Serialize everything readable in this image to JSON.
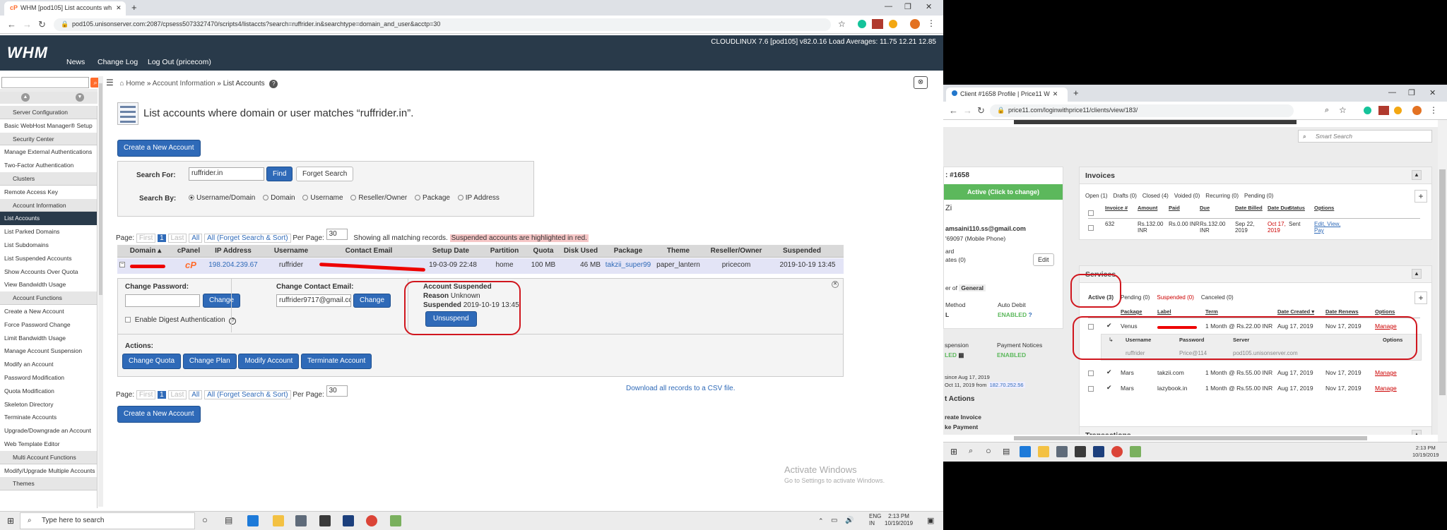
{
  "left_browser": {
    "tab_title": "WHM [pod105] List accounts wh",
    "url": "pod105.unisonserver.com:2087/cpsess5073327470/scripts4/listaccts?search=ruffrider.in&searchtype=domain_and_user&acctp=30"
  },
  "whm": {
    "logo": "WHM",
    "nav": [
      "News",
      "Change Log",
      "Log Out (pricecom)"
    ],
    "server_info": "CLOUDLINUX 7.6 [pod105]   v82.0.16   Load Averages: 11.75 12.21 12.85",
    "breadcrumb": [
      "Home",
      "Account Information",
      "List Accounts"
    ],
    "page_title": "List accounts where domain or user matches “ruffrider.in”.",
    "create_btn": "Create a New Account",
    "search_for_label": "Search For:",
    "search_value": "ruffrider.in",
    "find_btn": "Find",
    "forget_btn": "Forget Search",
    "search_by_label": "Search By:",
    "search_by_options": [
      "Username/Domain",
      "Domain",
      "Username",
      "Reseller/Owner",
      "Package",
      "IP Address"
    ],
    "pager": {
      "label": "Page:",
      "first": "First",
      "page": "1",
      "last": "Last",
      "all": "All",
      "all_forget": "All (Forget Search & Sort)",
      "per_page_label": "Per Page:",
      "per_page": "30",
      "showing": "Showing all matching records.",
      "suspended_note": "Suspended accounts are highlighted in red."
    },
    "columns": [
      "Domain ▴",
      "cPanel",
      "IP Address",
      "Username",
      "Contact Email",
      "Setup Date",
      "Partition",
      "Quota",
      "Disk Used",
      "Package",
      "Theme",
      "Reseller/Owner",
      "Suspended"
    ],
    "row": {
      "ip": "198.204.239.67",
      "username": "ruffrider",
      "setup_date": "19-03-09 22:48",
      "partition": "home",
      "quota": "100 MB",
      "disk_used": "46 MB",
      "package": "takzii_super99",
      "theme": "paper_lantern",
      "owner": "pricecom",
      "suspended": "2019-10-19 13:45"
    },
    "detail": {
      "change_password": "Change Password:",
      "change_btn": "Change",
      "digest": "Enable Digest Authentication",
      "change_email": "Change Contact Email:",
      "email_value": "ruffrider9717@gmail.cc",
      "suspended_title": "Account Suspended",
      "reason_label": "Reason",
      "reason_value": "Unknown",
      "suspended_label": "Suspended",
      "suspended_value": "2019-10-19 13:45",
      "unsuspend_btn": "Unsuspend",
      "actions_label": "Actions:",
      "actions": [
        "Change Quota",
        "Change Plan",
        "Modify Account",
        "Terminate Account"
      ]
    },
    "download_link": "Download all records to a CSV file.",
    "activate_title": "Activate Windows",
    "activate_sub": "Go to Settings to activate Windows.",
    "sidebar": [
      {
        "t": "h",
        "label": "Server Configuration"
      },
      {
        "t": "i",
        "label": "Basic WebHost Manager® Setup"
      },
      {
        "t": "h",
        "label": "Security Center"
      },
      {
        "t": "i",
        "label": "Manage External Authentications"
      },
      {
        "t": "i",
        "label": "Two-Factor Authentication"
      },
      {
        "t": "h",
        "label": "Clusters"
      },
      {
        "t": "i",
        "label": "Remote Access Key"
      },
      {
        "t": "h",
        "label": "Account Information"
      },
      {
        "t": "a",
        "label": "List Accounts"
      },
      {
        "t": "i",
        "label": "List Parked Domains"
      },
      {
        "t": "i",
        "label": "List Subdomains"
      },
      {
        "t": "i",
        "label": "List Suspended Accounts"
      },
      {
        "t": "i",
        "label": "Show Accounts Over Quota"
      },
      {
        "t": "i",
        "label": "View Bandwidth Usage"
      },
      {
        "t": "h",
        "label": "Account Functions"
      },
      {
        "t": "i",
        "label": "Create a New Account"
      },
      {
        "t": "i",
        "label": "Force Password Change"
      },
      {
        "t": "i",
        "label": "Limit Bandwidth Usage"
      },
      {
        "t": "i",
        "label": "Manage Account Suspension"
      },
      {
        "t": "i",
        "label": "Modify an Account"
      },
      {
        "t": "i",
        "label": "Password Modification"
      },
      {
        "t": "i",
        "label": "Quota Modification"
      },
      {
        "t": "i",
        "label": "Skeleton Directory"
      },
      {
        "t": "i",
        "label": "Terminate Accounts"
      },
      {
        "t": "i",
        "label": "Upgrade/Downgrade an Account"
      },
      {
        "t": "i",
        "label": "Web Template Editor"
      },
      {
        "t": "h",
        "label": "Multi Account Functions"
      },
      {
        "t": "i",
        "label": "Modify/Upgrade Multiple Accounts"
      },
      {
        "t": "h",
        "label": "Themes"
      }
    ]
  },
  "taskbar_left": {
    "search": "Type here to search",
    "lang": "ENG",
    "region": "IN",
    "time": "2:13 PM",
    "date": "10/19/2019"
  },
  "right_browser": {
    "tab_title": "Client #1658 Profile | Price11 W",
    "url": "price11.com/loginwithprice11/clients/view/183/",
    "smart_search": "Smart Search",
    "client_id": ": #1658",
    "status_btn": "Active (Click to change)",
    "name_frag": "Zi",
    "email_frag": "amsaini110.ss@gmail.com",
    "phone_frag": "'69097 (Mobile Phone)",
    "frag_ard": "ard",
    "frag_ates": "ates (0)",
    "edit_btn": "Edit",
    "frag_er_of": "er of",
    "general_badge": "General",
    "method_label": "Method",
    "auto_debit": "Auto Debit",
    "enabled": "ENABLED",
    "help_q": "?",
    "frag_l": "L",
    "spension": "spension",
    "payment_notices": "Payment Notices",
    "led": "LED",
    "since": "since Aug 17, 2019",
    "oct": "Oct 11, 2019 from",
    "ip": "182.70.252.56",
    "t_actions": "t Actions",
    "create_invoice": "reate Invoice",
    "ke_payment": "ke Payment",
    "invoices": {
      "title": "Invoices",
      "filters": [
        "Open (1)",
        "Drafts (0)",
        "Closed (4)",
        "Voided (0)",
        "Recurring (0)",
        "Pending (0)"
      ],
      "cols": [
        "Invoice #",
        "Amount",
        "Paid",
        "Due",
        "Date Billed",
        "Date Due",
        "Status",
        "Options"
      ],
      "row": [
        "632",
        "Rs.132.00 INR",
        "Rs.0.00 INR",
        "Rs.132.00 INR",
        "Sep 22, 2019",
        "Oct 17, 2019",
        "Sent",
        "Edit, View, Pay"
      ]
    },
    "services": {
      "title": "Services",
      "filters": [
        "Active (3)",
        "Pending (0)",
        "Suspended (0)",
        "Canceled (0)"
      ],
      "cols": [
        "Package",
        "Label",
        "Term",
        "Date Created ▾",
        "Date Renews",
        "Options"
      ],
      "rows": [
        [
          "Venus",
          "",
          "1 Month @ Rs.22.00 INR",
          "Aug 17, 2019",
          "Nov 17, 2019",
          "Manage"
        ],
        [
          "Mars",
          "takzii.com",
          "1 Month @ Rs.55.00 INR",
          "Aug 17, 2019",
          "Nov 17, 2019",
          "Manage"
        ],
        [
          "Mars",
          "lazybook.in",
          "1 Month @ Rs.55.00 INR",
          "Aug 17, 2019",
          "Nov 17, 2019",
          "Manage"
        ]
      ],
      "sub_cols": [
        "Username",
        "Password",
        "Server",
        "Options"
      ],
      "sub_row": [
        "ruffrider",
        "Price@114",
        "pod105.unisonserver.com"
      ]
    },
    "transactions": "Transactions"
  },
  "taskbar_right": {
    "time": "2:13 PM",
    "date": "10/19/2019"
  }
}
